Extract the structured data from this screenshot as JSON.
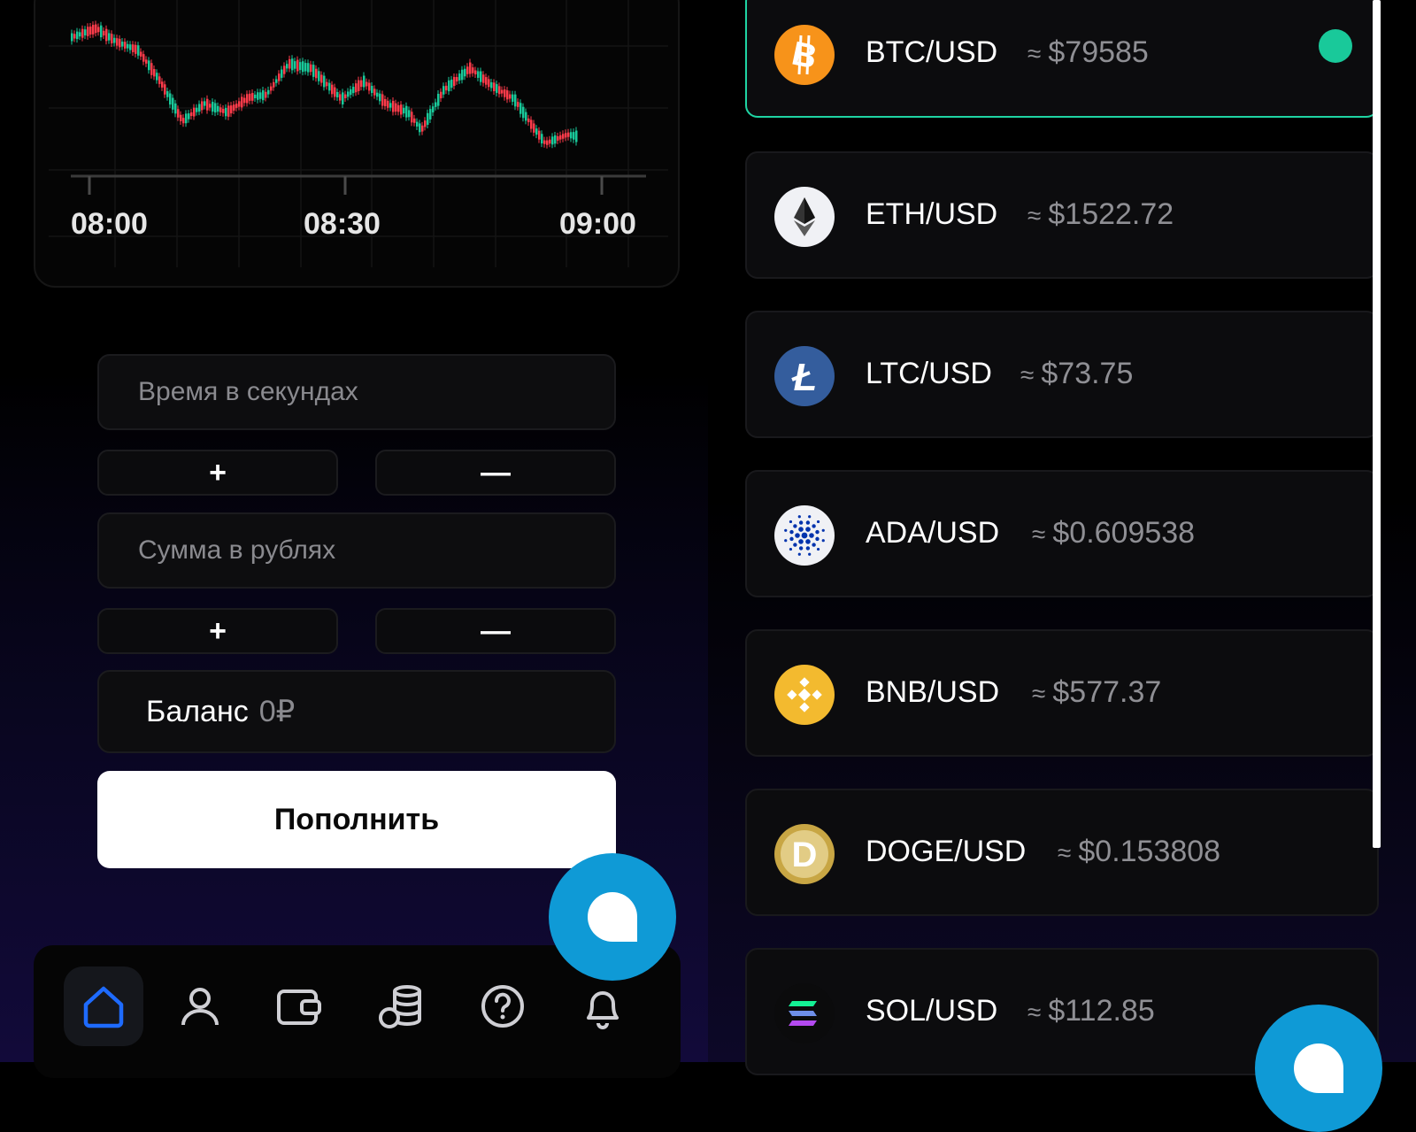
{
  "chart": {
    "tick_labels": [
      "08:00",
      "08:30",
      "09:00"
    ],
    "up_color": "#19c99a",
    "down_color": "#ff3b4a"
  },
  "form": {
    "time_placeholder": "Время в секундах",
    "amount_placeholder": "Сумма в рублях",
    "plus_label": "+",
    "minus_label": "—",
    "balance_label": "Баланс",
    "balance_value": "0₽",
    "topup_label": "Пополнить"
  },
  "nav": {
    "items": [
      "home-icon",
      "user-icon",
      "wallet-icon",
      "coins-icon",
      "help-icon",
      "bell-icon"
    ],
    "active": "home-icon",
    "active_color": "#1e6bff"
  },
  "coins": [
    {
      "pair": "BTC/USD",
      "approx": "≈",
      "price": "$79585",
      "icon": "bitcoin-icon",
      "color": "#f7931a",
      "selected": true
    },
    {
      "pair": "ETH/USD",
      "approx": "≈",
      "price": "$1522.72",
      "icon": "ethereum-icon",
      "color": "#f0f1f5"
    },
    {
      "pair": "LTC/USD",
      "approx": "≈",
      "price": "$73.75",
      "icon": "litecoin-icon",
      "color": "#345d9d"
    },
    {
      "pair": "ADA/USD",
      "approx": "≈",
      "price": "$0.609538",
      "icon": "cardano-icon",
      "color": "#f0f1f5"
    },
    {
      "pair": "BNB/USD",
      "approx": "≈",
      "price": "$577.37",
      "icon": "bnb-icon",
      "color": "#f3ba2f"
    },
    {
      "pair": "DOGE/USD",
      "approx": "≈",
      "price": "$0.153808",
      "icon": "doge-icon",
      "color": "#c8a644"
    },
    {
      "pair": "SOL/USD",
      "approx": "≈",
      "price": "$112.85",
      "icon": "solana-icon",
      "color": "#0b0b0c"
    }
  ],
  "accent_color": "#1fd4a3",
  "fab_color": "#0f9ad6"
}
